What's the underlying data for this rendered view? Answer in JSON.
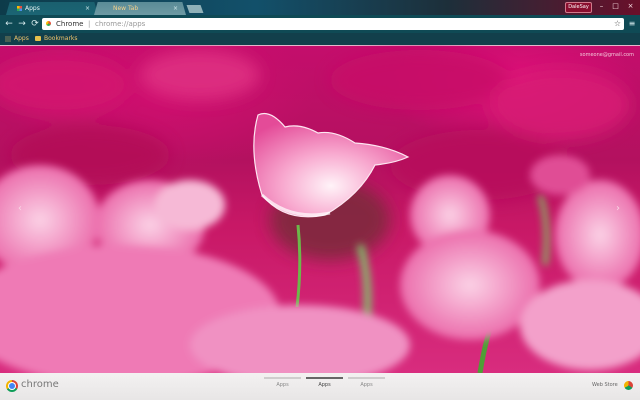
{
  "tabs": [
    {
      "title": "Apps",
      "close_glyph": "×"
    },
    {
      "title": "New Tab",
      "close_glyph": "×"
    }
  ],
  "window": {
    "user_label": "DaleSay",
    "minimize_glyph": "–",
    "maximize_glyph": "□",
    "close_glyph": "×"
  },
  "toolbar": {
    "back_glyph": "←",
    "forward_glyph": "→",
    "reload_glyph": "⟳",
    "omnibox_chip": "Chrome",
    "omnibox_sep": "|",
    "omnibox_url": "chrome://apps",
    "star_glyph": "☆",
    "menu_glyph": "≡"
  },
  "bookmarks": [
    {
      "label": "Apps",
      "icon": "apps-grid-icon"
    },
    {
      "label": "Bookmarks",
      "icon": "folder-icon"
    }
  ],
  "content": {
    "account_email": "someone@gmail.com",
    "prev_arrow": "‹",
    "next_arrow": "›"
  },
  "footer": {
    "brand": "chrome",
    "page_tabs": [
      {
        "label": "Apps",
        "active": false
      },
      {
        "label": "Apps",
        "active": true
      },
      {
        "label": "Apps",
        "active": false
      }
    ],
    "web_store_label": "Web Store"
  },
  "colors": {
    "titlebar": "#0d3b4a",
    "toolbar": "#0f4a55",
    "bookmark_text": "#f2c46b",
    "background_pink": "#c2185b"
  }
}
